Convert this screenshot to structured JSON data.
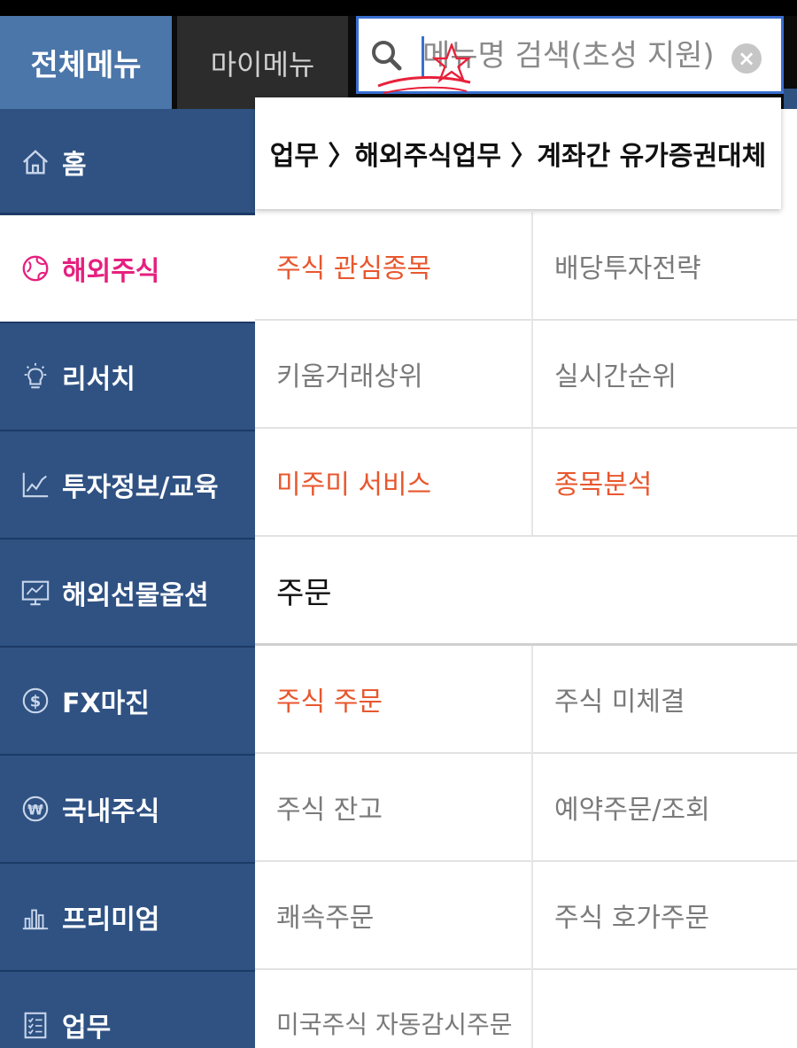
{
  "tabs": {
    "all_menu": "전체메뉴",
    "my_menu": "마이메뉴"
  },
  "search": {
    "placeholder": "메뉴명 검색(초성 지원)",
    "value": "",
    "clear_icon": "x-circle-icon"
  },
  "breadcrumb": {
    "text": "업무 〉해외주식업무 〉계좌간 유가증권대체"
  },
  "sidebar": {
    "items": [
      {
        "label": "홈",
        "icon": "home-icon"
      },
      {
        "label": "해외주식",
        "icon": "globe-icon"
      },
      {
        "label": "리서치",
        "icon": "lightbulb-icon"
      },
      {
        "label": "투자정보/교육",
        "icon": "line-chart-icon"
      },
      {
        "label": "해외선물옵션",
        "icon": "monitor-chart-icon"
      },
      {
        "label": "FX마진",
        "icon": "dollar-icon"
      },
      {
        "label": "국내주식",
        "icon": "won-icon"
      },
      {
        "label": "프리미엄",
        "icon": "bar-chart-icon"
      },
      {
        "label": "업무",
        "icon": "checklist-icon"
      }
    ]
  },
  "menu": {
    "row1": [
      "주식 관심종목",
      "배당투자전략"
    ],
    "row2": [
      "키움거래상위",
      "실시간순위"
    ],
    "row3": [
      "미주미 서비스",
      "종목분석"
    ],
    "section_order": "주문",
    "row5": [
      "주식 주문",
      "주식 미체결"
    ],
    "row6": [
      "주식 잔고",
      "예약주문/조회"
    ],
    "row7": [
      "쾌속주문",
      "주식 호가주문"
    ],
    "row8": [
      "미국주식 자동감시주문"
    ]
  },
  "colors": {
    "sidebar_bg": "#2f5283",
    "active_tab": "#4b76a9",
    "active_text": "#e6207f",
    "highlight_text": "#e8572e"
  }
}
